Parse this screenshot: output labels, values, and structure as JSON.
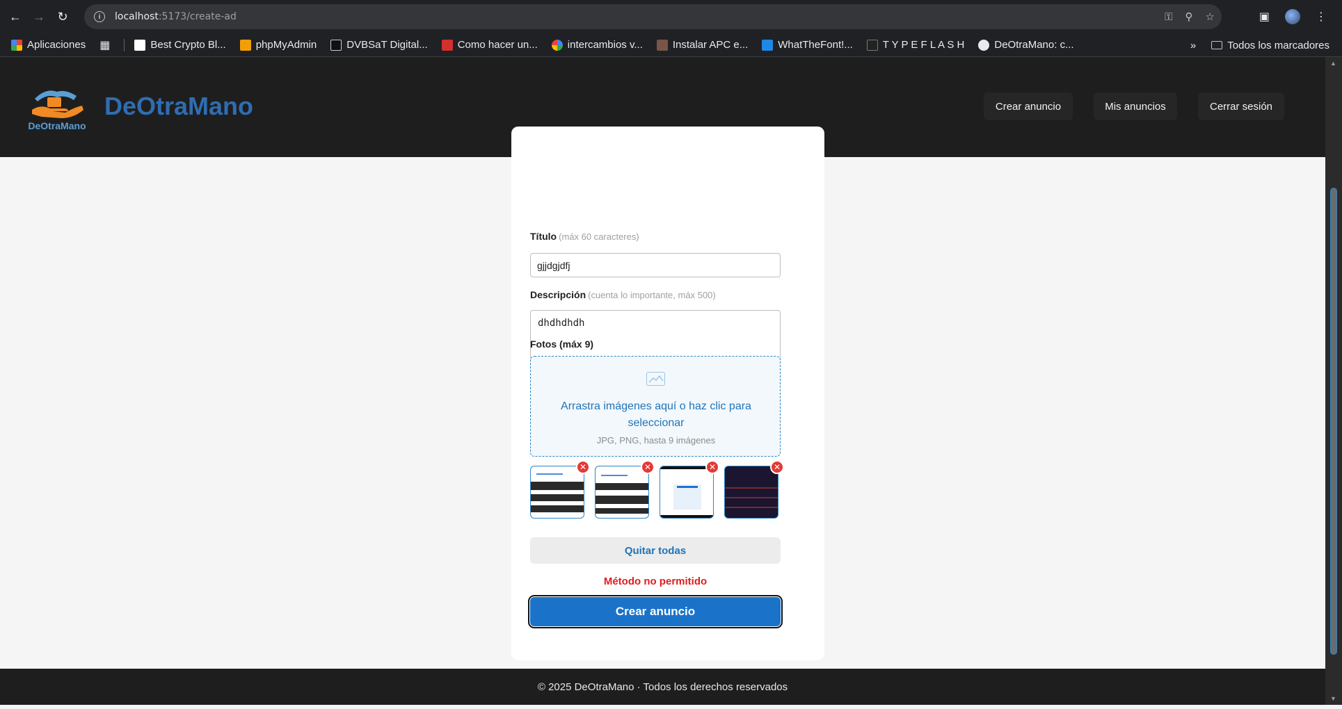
{
  "browser": {
    "url_host": "localhost",
    "url_path": ":5173/create-ad",
    "bookmarks": [
      {
        "label": "Aplicaciones",
        "color": "#ea4335"
      },
      {
        "label": "Best Crypto Bl...",
        "color": "#ffffff"
      },
      {
        "label": "phpMyAdmin",
        "color": "#f29f05"
      },
      {
        "label": "DVBSaT Digital...",
        "color": "#111111"
      },
      {
        "label": "Como hacer un...",
        "color": "#d32f2f"
      },
      {
        "label": "intercambios v...",
        "color": "#4285f4"
      },
      {
        "label": "Instalar APC e...",
        "color": "#795548"
      },
      {
        "label": "WhatTheFont!...",
        "color": "#1e88e5"
      },
      {
        "label": "T Y P E F L A S H",
        "color": "#222222"
      },
      {
        "label": "DeOtraMano: c...",
        "color": "#e8eaed"
      }
    ],
    "all_bookmarks": "Todos los marcadores"
  },
  "header": {
    "logo_caption": "DeOtraMano",
    "brand": "DeOtraMano",
    "nav": [
      "Crear anuncio",
      "Mis anuncios",
      "Cerrar sesión"
    ]
  },
  "form": {
    "title_label": "Título",
    "title_hint": "(máx 60 caracteres)",
    "title_value": "gjjdgjdfj",
    "desc_label": "Descripción",
    "desc_hint": "(cuenta lo importante, máx 500)",
    "desc_value": "dhdhdhdh",
    "photos_label": "Fotos (máx 9)",
    "dropzone_main": "Arrastra imágenes aquí o haz clic para seleccionar",
    "dropzone_sub": "JPG, PNG, hasta 9 imágenes",
    "photo_count": 4,
    "clear_all": "Quitar todas",
    "error": "Método no permitido",
    "submit": "Crear anuncio"
  },
  "footer": {
    "text": "© 2025 DeOtraMano · Todos los derechos reservados"
  },
  "colors": {
    "brand_blue": "#2f6db0",
    "primary": "#1a73c9",
    "error": "#e21b1b",
    "header_bg": "#1e1e1f"
  }
}
